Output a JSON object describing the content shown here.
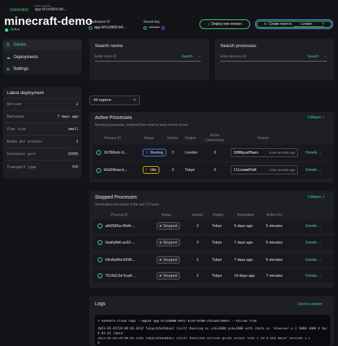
{
  "header": {
    "back_label": "OVERVIEW",
    "app_caption": "APPLICATION",
    "app_short": "app-6f1c0800-b0...",
    "app_name": "minecraft-demo",
    "status": "Active",
    "app_id_label": "Application ID",
    "app_id_value": "app-6f1c0800-b0...",
    "secret_label": "Secret key",
    "secret_value": "••••••••",
    "deploy_button": "Deploy new version",
    "create_button": "Create room in",
    "region_value": "London"
  },
  "sidebar": {
    "nav": [
      {
        "label": "Details"
      },
      {
        "label": "Deployments"
      },
      {
        "label": "Settings"
      }
    ],
    "latest_title": "Latest deployment",
    "fields": [
      {
        "key": "Version",
        "value": "2"
      },
      {
        "key": "Deployed",
        "value": "7 days ago"
      },
      {
        "key": "Plan size",
        "value": "small"
      },
      {
        "key": "Rooms per process",
        "value": "1"
      },
      {
        "key": "Container port",
        "value": "25565"
      },
      {
        "key": "Transport type",
        "value": "TCP"
      }
    ]
  },
  "search_rooms": {
    "title": "Search rooms",
    "placeholder": "Enter room ID",
    "action": "Search"
  },
  "search_processes": {
    "title": "Search processes",
    "placeholder": "Enter process ID",
    "action": "Search"
  },
  "region_filter": "All regions",
  "active": {
    "title": "Active Processes",
    "subtitle": "Running processes, ordered from most to least recent rooms",
    "collapse": "Collapse",
    "headers": [
      "Process ID",
      "Status",
      "Version",
      "Region",
      "Active Connections",
      "Rooms"
    ],
    "rows": [
      {
        "pid": "26786bdc-9...",
        "status": "Starting",
        "version": "2",
        "region": "London",
        "conns": "0",
        "room": "1808pya95wes",
        "room_time": "a few seconds ago",
        "details": "Details"
      },
      {
        "pid": "b5d26baa-b...",
        "status": "Idle",
        "version": "2",
        "region": "Tokyo",
        "conns": "0",
        "room": "t11cewm0fm8",
        "room_time": "a few seconds ago",
        "details": "Details"
      }
    ]
  },
  "stopped": {
    "title": "Stopped Processes",
    "subtitle": "Terminated processes in the last 72 hours",
    "collapse": "Collapse",
    "headers": [
      "Process ID",
      "Status",
      "Version",
      "Region",
      "Terminated",
      "Active For"
    ],
    "rows": [
      {
        "pid": "afb3565a-06d4-...",
        "status": "Stopped",
        "version": "2",
        "region": "Tokyo",
        "terminated": "6 days ago",
        "active_for": "5 minutes",
        "details": "Details"
      },
      {
        "pid": "0aafa9b6-ac62-...",
        "status": "Stopped",
        "version": "2",
        "region": "Tokyo",
        "terminated": "7 days ago",
        "active_for": "5 minutes",
        "details": "Details"
      },
      {
        "pid": "04c8a40d-6298...",
        "status": "Stopped",
        "version": "1",
        "region": "Tokyo",
        "terminated": "7 days ago",
        "active_for": "5 minutes",
        "details": "Details"
      },
      {
        "pid": "7518d12d-5ca8-...",
        "status": "Stopped",
        "version": "1",
        "region": "Tokyo",
        "terminated": "14 days ago",
        "active_for": "7 minutes",
        "details": "Details"
      }
    ]
  },
  "logs": {
    "title": "Logs",
    "scroll_label": "Scroll to bottom",
    "command_prompt": "> hathora-cloud logs --appId app-6f1c0800-b95c-41c9-bc00-2fb33d7396e1 --follow true",
    "lines": [
      "2023-05-01T20:09:03.821Z Tokyo[b5d26baa] [init] Running as uid=1000 gid=1000 with /data as 'drwxrwxr-x 2 1000 1000 4 Apr 9 03:45 /data'",
      "2023-05-01T20:09:05.519Z Tokyo[b5d26baa] [init] Resolved version given LATEST into 1.19.4 and major version 1.1"
    ],
    "tail": "9"
  },
  "colors": {
    "accent": "#3ddc84",
    "starting": "#3b82f6",
    "idle": "#eab308",
    "panel": "#1e1e25",
    "bg": "#131318"
  }
}
